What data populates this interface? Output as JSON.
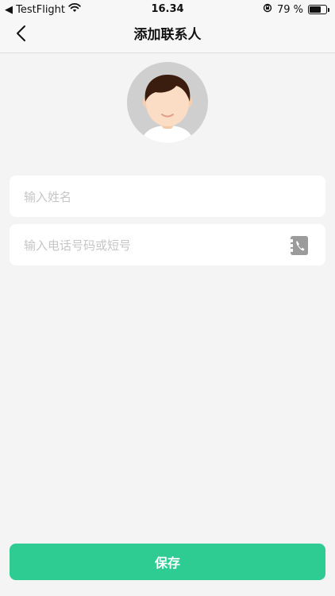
{
  "status_bar": {
    "back_app": "◀ TestFlight",
    "time": "16.34",
    "battery_text": "79 %",
    "battery_level": 0.79
  },
  "nav": {
    "title": "添加联系人"
  },
  "form": {
    "name_placeholder": "输入姓名",
    "name_value": "",
    "phone_placeholder": "输入电话号码或短号",
    "phone_value": ""
  },
  "actions": {
    "save_label": "保存"
  },
  "colors": {
    "primary": "#2ecc93",
    "background": "#f4f4f4"
  },
  "icons": {
    "back": "chevron-left-icon",
    "contacts": "contact-book-icon",
    "wifi": "wifi-icon",
    "lock": "orientation-lock-icon",
    "battery": "battery-icon"
  }
}
